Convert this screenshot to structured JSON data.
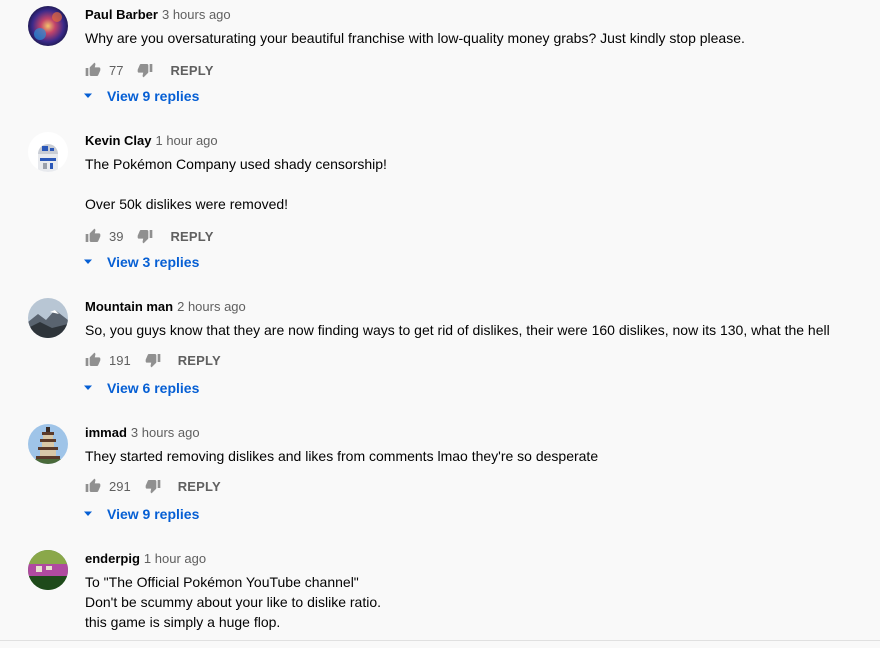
{
  "theme": {
    "link_color": "#065fd4",
    "meta_color": "#606060",
    "text_color": "#030303"
  },
  "comments": [
    {
      "author": "Paul Barber",
      "time": "3 hours ago",
      "lines": [
        "Why are you oversaturating your beautiful franchise with low-quality money grabs? Just kindly stop please."
      ],
      "likes": "77",
      "reply_label": "REPLY",
      "view_replies": "View 9 replies",
      "avatar": "galaxy-avatar"
    },
    {
      "author": "Kevin Clay",
      "time": "1 hour ago",
      "lines": [
        "The Pokémon Company used shady censorship!",
        "",
        "Over 50k dislikes were removed!"
      ],
      "likes": "39",
      "reply_label": "REPLY",
      "view_replies": "View 3 replies",
      "avatar": "robot-avatar"
    },
    {
      "author": "Mountain man",
      "time": "2 hours ago",
      "lines": [
        "So, you guys know that they are now finding ways to get rid of dislikes, their were 160 dislikes, now its 130, what the hell"
      ],
      "likes": "191",
      "reply_label": "REPLY",
      "view_replies": "View 6 replies",
      "avatar": "mountain-avatar"
    },
    {
      "author": "immad",
      "time": "3 hours ago",
      "lines": [
        "They started removing dislikes and likes from comments lmao they're so desperate"
      ],
      "likes": "291",
      "reply_label": "REPLY",
      "view_replies": "View 9 replies",
      "avatar": "pagoda-avatar"
    },
    {
      "author": "enderpig",
      "time": "1 hour ago",
      "lines": [
        "To \"The Official Pokémon YouTube channel\"",
        "Don't be scummy about your like to dislike ratio.",
        "this game is simply a huge flop."
      ],
      "avatar": "pixel-avatar"
    }
  ]
}
